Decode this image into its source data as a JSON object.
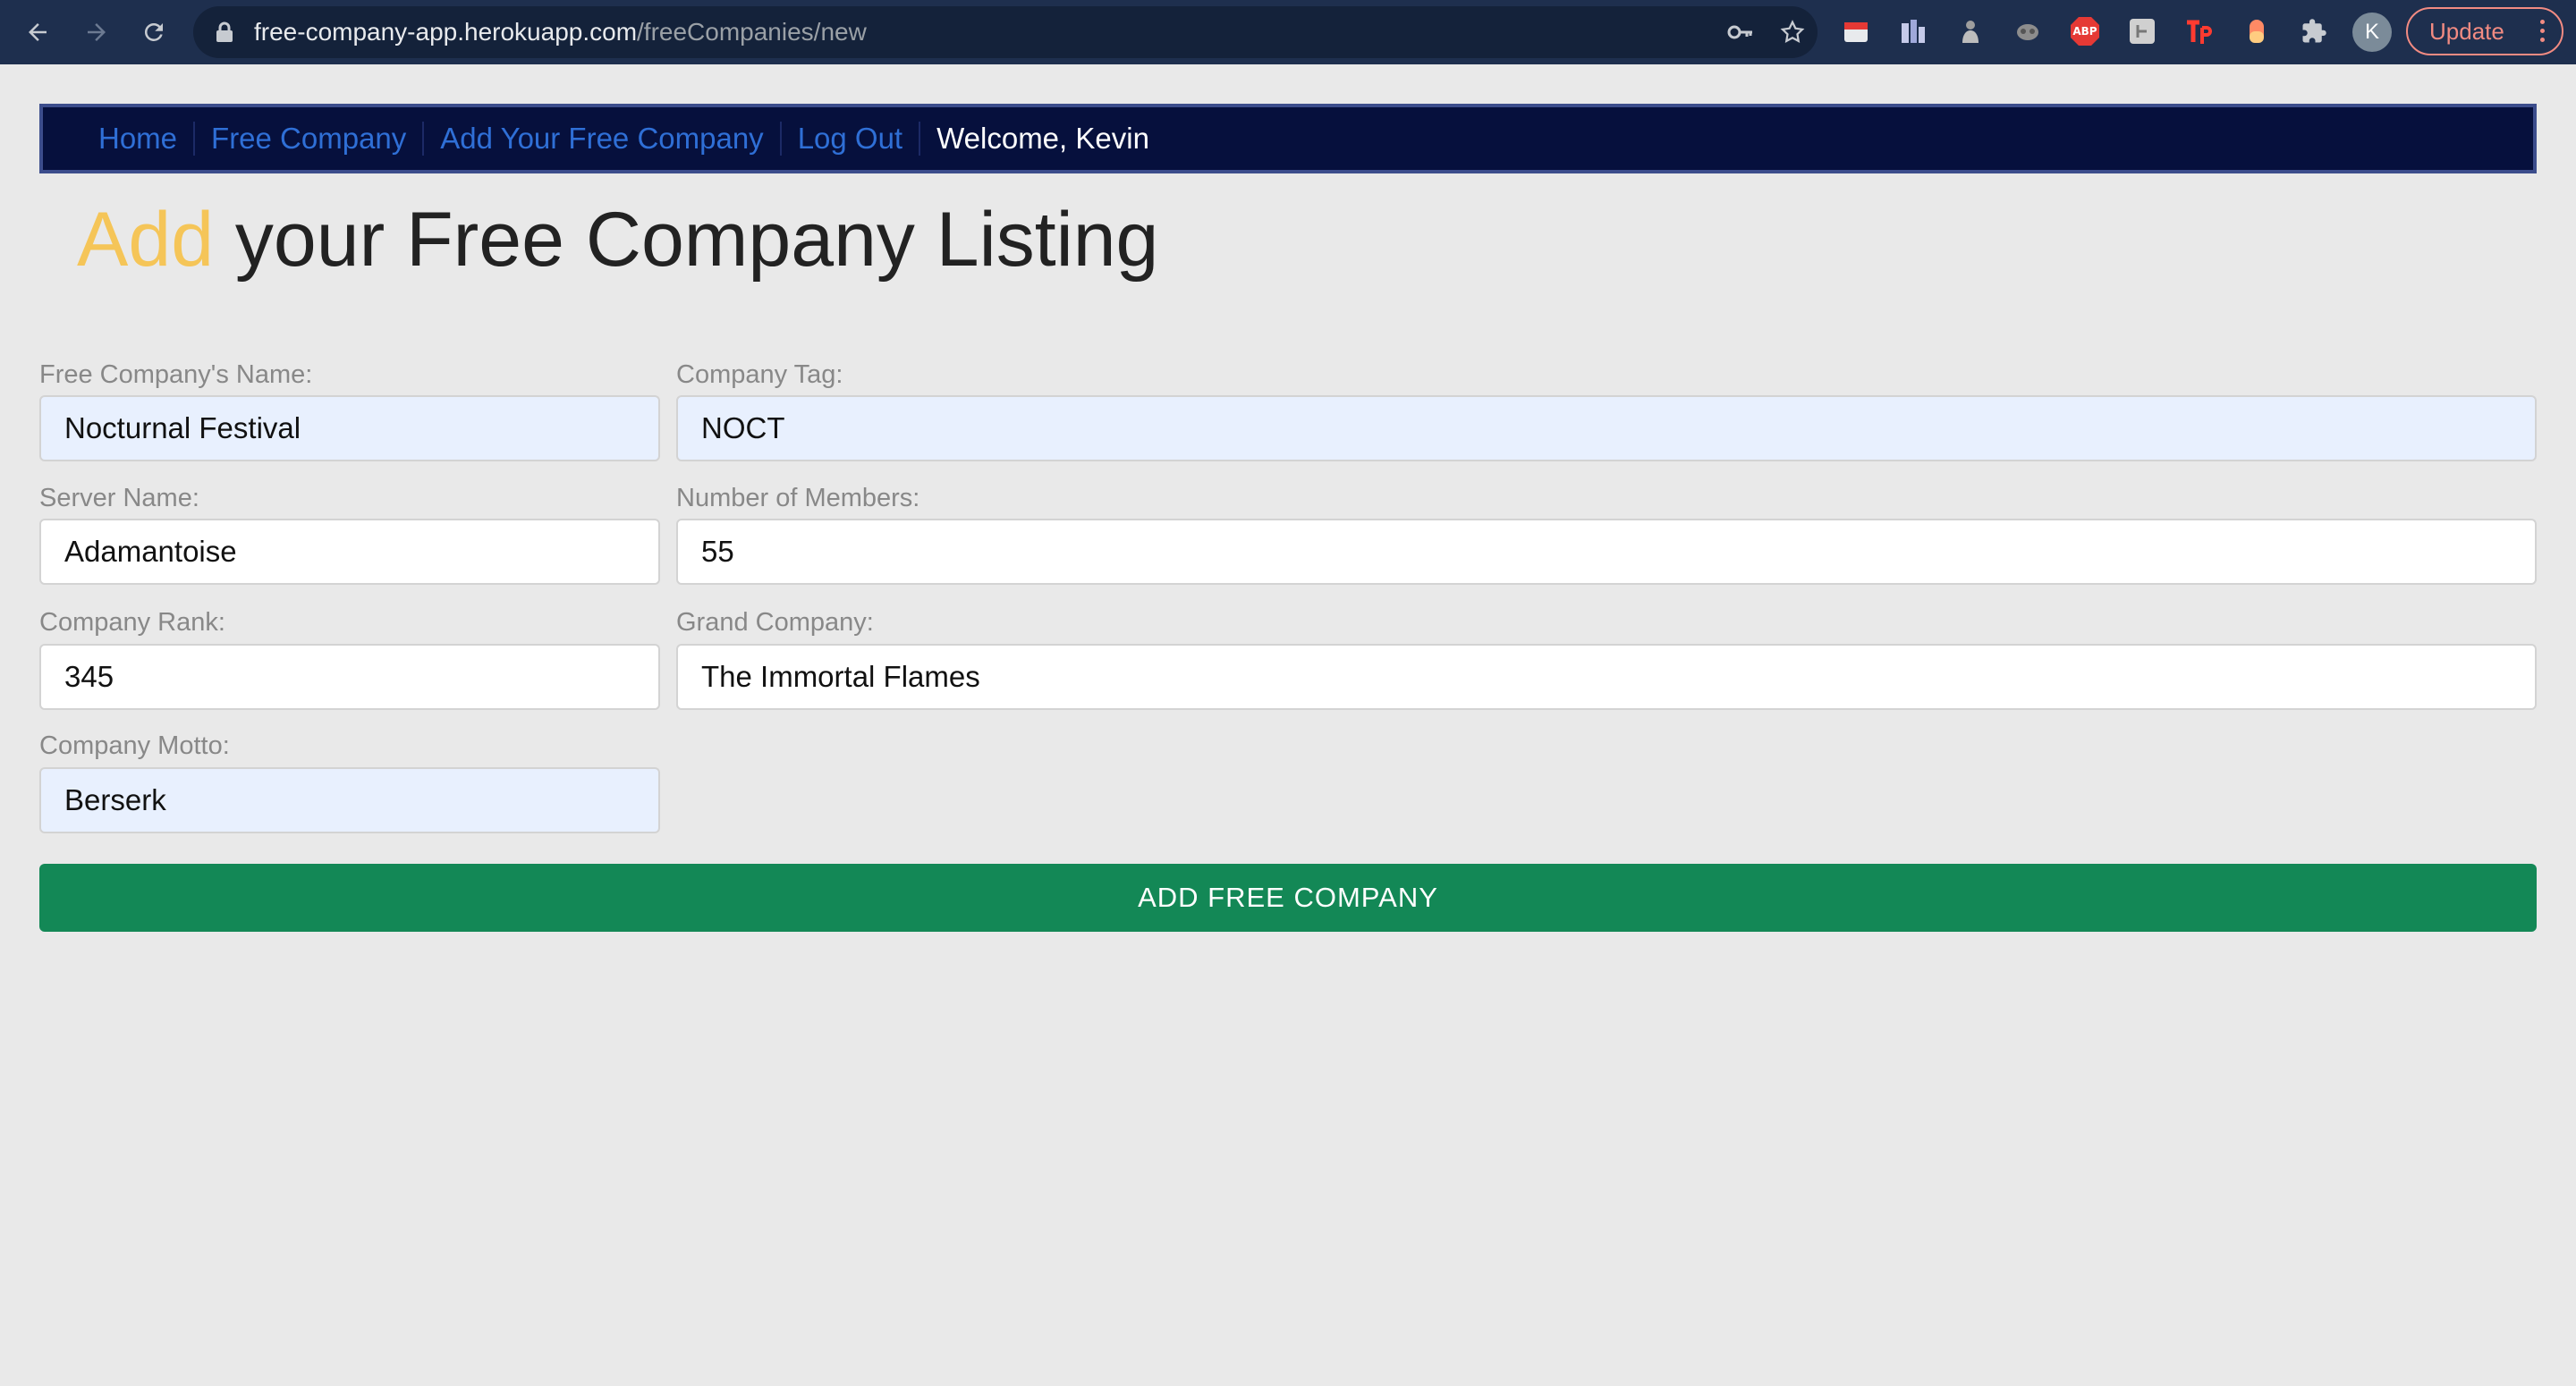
{
  "browser": {
    "url_host": "free-company-app.herokuapp.com",
    "url_path": "/freeCompanies/new",
    "profile_initial": "K",
    "update_label": "Update",
    "extensions": [
      "ABP"
    ]
  },
  "nav": {
    "home": "Home",
    "free_company": "Free Company",
    "add_free_company": "Add Your Free Company",
    "log_out": "Log Out",
    "welcome": "Welcome, Kevin"
  },
  "page": {
    "title_accent": "Add",
    "title_rest": " your Free Company Listing"
  },
  "form": {
    "name_label": "Free Company's Name:",
    "name_value": "Nocturnal Festival",
    "tag_label": "Company Tag:",
    "tag_value": "NOCT",
    "server_label": "Server Name:",
    "server_value": "Adamantoise",
    "members_label": "Number of Members:",
    "members_value": "55",
    "rank_label": "Company Rank:",
    "rank_value": "345",
    "grand_label": "Grand Company:",
    "grand_value": "The Immortal Flames",
    "motto_label": "Company Motto:",
    "motto_value": "Berserk",
    "submit_label": "ADD FREE COMPANY"
  },
  "colors": {
    "nav_background": "#06103d",
    "link": "#2f6fd6",
    "title_accent": "#f5c558",
    "submit": "#138856",
    "autofill": "#e8f0fe"
  }
}
